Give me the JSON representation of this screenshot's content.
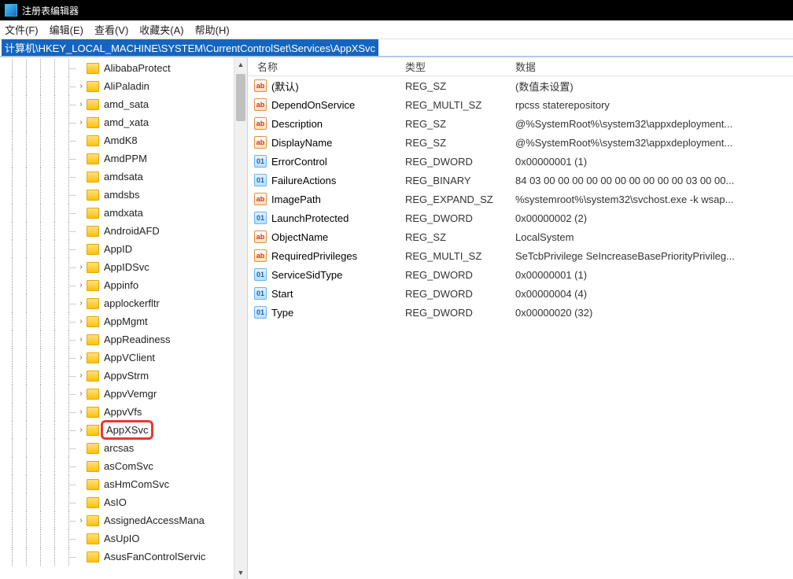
{
  "title": "注册表编辑器",
  "menu": {
    "file": "文件(F)",
    "edit": "编辑(E)",
    "view": "查看(V)",
    "favorites": "收藏夹(A)",
    "help": "帮助(H)"
  },
  "path": "计算机\\HKEY_LOCAL_MACHINE\\SYSTEM\\CurrentControlSet\\Services\\AppXSvc",
  "tree": [
    {
      "expander": "",
      "label": "AlibabaProtect"
    },
    {
      "expander": "›",
      "label": "AliPaladin"
    },
    {
      "expander": "›",
      "label": "amd_sata"
    },
    {
      "expander": "›",
      "label": "amd_xata"
    },
    {
      "expander": "",
      "label": "AmdK8"
    },
    {
      "expander": "",
      "label": "AmdPPM"
    },
    {
      "expander": "",
      "label": "amdsata"
    },
    {
      "expander": "",
      "label": "amdsbs"
    },
    {
      "expander": "",
      "label": "amdxata"
    },
    {
      "expander": "",
      "label": "AndroidAFD"
    },
    {
      "expander": "",
      "label": "AppID"
    },
    {
      "expander": "›",
      "label": "AppIDSvc"
    },
    {
      "expander": "›",
      "label": "Appinfo"
    },
    {
      "expander": "›",
      "label": "applockerfltr"
    },
    {
      "expander": "›",
      "label": "AppMgmt"
    },
    {
      "expander": "›",
      "label": "AppReadiness"
    },
    {
      "expander": "›",
      "label": "AppVClient"
    },
    {
      "expander": "›",
      "label": "AppvStrm"
    },
    {
      "expander": "›",
      "label": "AppvVemgr"
    },
    {
      "expander": "›",
      "label": "AppvVfs"
    },
    {
      "expander": "›",
      "label": "AppXSvc",
      "selected": true
    },
    {
      "expander": "",
      "label": "arcsas"
    },
    {
      "expander": "",
      "label": "asComSvc"
    },
    {
      "expander": "",
      "label": "asHmComSvc"
    },
    {
      "expander": "",
      "label": "AsIO"
    },
    {
      "expander": "›",
      "label": "AssignedAccessMana"
    },
    {
      "expander": "",
      "label": "AsUpIO"
    },
    {
      "expander": "",
      "label": "AsusFanControlServic"
    }
  ],
  "columns": {
    "name": "名称",
    "type": "类型",
    "data": "数据"
  },
  "values": [
    {
      "ico": "str",
      "name": "(默认)",
      "type": "REG_SZ",
      "data": "(数值未设置)"
    },
    {
      "ico": "str",
      "name": "DependOnService",
      "type": "REG_MULTI_SZ",
      "data": "rpcss staterepository"
    },
    {
      "ico": "str",
      "name": "Description",
      "type": "REG_SZ",
      "data": "@%SystemRoot%\\system32\\appxdeployment..."
    },
    {
      "ico": "str",
      "name": "DisplayName",
      "type": "REG_SZ",
      "data": "@%SystemRoot%\\system32\\appxdeployment..."
    },
    {
      "ico": "bin",
      "name": "ErrorControl",
      "type": "REG_DWORD",
      "data": "0x00000001 (1)"
    },
    {
      "ico": "bin",
      "name": "FailureActions",
      "type": "REG_BINARY",
      "data": "84 03 00 00 00 00 00 00 00 00 00 00 03 00 00..."
    },
    {
      "ico": "str",
      "name": "ImagePath",
      "type": "REG_EXPAND_SZ",
      "data": "%systemroot%\\system32\\svchost.exe -k wsap..."
    },
    {
      "ico": "bin",
      "name": "LaunchProtected",
      "type": "REG_DWORD",
      "data": "0x00000002 (2)"
    },
    {
      "ico": "str",
      "name": "ObjectName",
      "type": "REG_SZ",
      "data": "LocalSystem"
    },
    {
      "ico": "str",
      "name": "RequiredPrivileges",
      "type": "REG_MULTI_SZ",
      "data": "SeTcbPrivilege SeIncreaseBasePriorityPrivileg..."
    },
    {
      "ico": "bin",
      "name": "ServiceSidType",
      "type": "REG_DWORD",
      "data": "0x00000001 (1)"
    },
    {
      "ico": "bin",
      "name": "Start",
      "type": "REG_DWORD",
      "data": "0x00000004 (4)"
    },
    {
      "ico": "bin",
      "name": "Type",
      "type": "REG_DWORD",
      "data": "0x00000020 (32)"
    }
  ]
}
